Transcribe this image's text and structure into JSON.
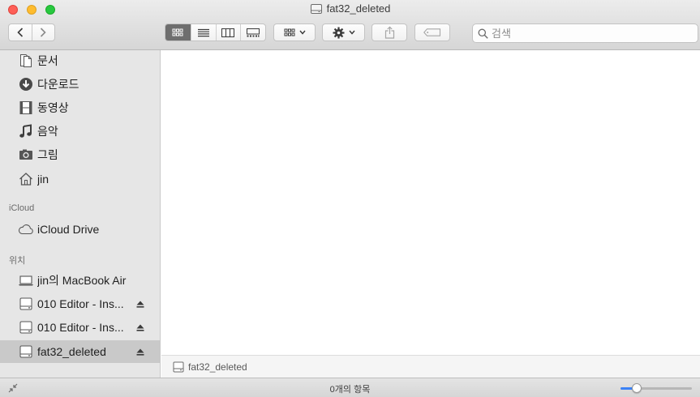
{
  "window": {
    "title": "fat32_deleted"
  },
  "toolbar": {
    "search_placeholder": "검색",
    "view_modes": [
      "icon",
      "list",
      "column",
      "gallery"
    ],
    "active_view": "icon"
  },
  "sidebar": {
    "favorites": [
      {
        "label": "문서",
        "icon": "document-icon"
      },
      {
        "label": "다운로드",
        "icon": "download-icon"
      },
      {
        "label": "동영상",
        "icon": "film-icon"
      },
      {
        "label": "음악",
        "icon": "music-note-icon"
      },
      {
        "label": "그림",
        "icon": "camera-icon"
      },
      {
        "label": "jin",
        "icon": "home-icon"
      }
    ],
    "icloud_header": "iCloud",
    "icloud_items": [
      {
        "label": "iCloud Drive",
        "icon": "cloud-icon"
      }
    ],
    "locations_header": "위치",
    "locations": [
      {
        "label": "jin의 MacBook Air",
        "icon": "laptop-icon"
      },
      {
        "label": "010 Editor - Ins...",
        "icon": "disk-icon",
        "ejectable": true
      },
      {
        "label": "010 Editor - Ins...",
        "icon": "disk-icon",
        "ejectable": true
      },
      {
        "label": "fat32_deleted",
        "icon": "disk-icon",
        "ejectable": true,
        "selected": true
      }
    ]
  },
  "pathbar": {
    "label": "fat32_deleted"
  },
  "statusbar": {
    "item_count_text": "0개의 항목",
    "icon_size_fraction": 0.18
  },
  "colors": {
    "accent": "#3b82f6",
    "sidebar_bg": "#e6e6e6",
    "selected_bg": "#c9c9c9"
  }
}
